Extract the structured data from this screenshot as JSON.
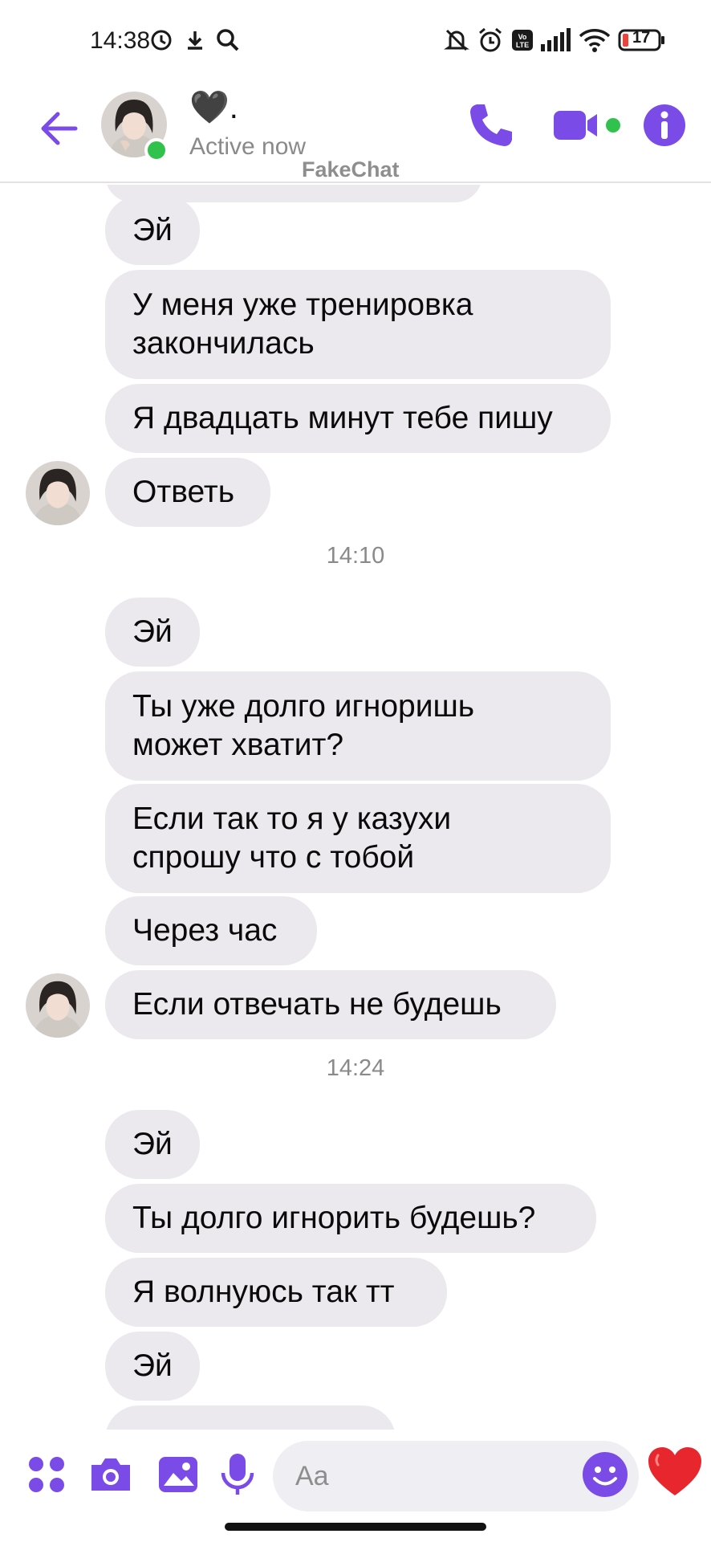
{
  "status_bar": {
    "time": "14:38",
    "battery": "17",
    "icons": [
      "clock-icon",
      "download-icon",
      "search-icon",
      "bell-off-icon",
      "alarm-icon",
      "volte-icon",
      "signal-icon",
      "wifi-icon",
      "battery-icon"
    ]
  },
  "header": {
    "contact_name": "🖤.",
    "contact_status": "Active now",
    "watermark": "FakeChat",
    "accent_color": "#7b4be8",
    "online_color": "#31c24d"
  },
  "messages": [
    {
      "text": "Эй",
      "avatar": false
    },
    {
      "text": "У меня уже тренировка\nзакончилась",
      "avatar": false
    },
    {
      "text": "Я двадцать минут тебе пишу",
      "avatar": false
    },
    {
      "text": "Ответь",
      "avatar": true
    },
    {
      "separator": "14:10"
    },
    {
      "text": "Эй",
      "avatar": false
    },
    {
      "text": "Ты уже долго игноришь\nможет хватит?",
      "avatar": false
    },
    {
      "text": "Если так то я у казухи\nспрошу что с тобой",
      "avatar": false
    },
    {
      "text": "Через час",
      "avatar": false
    },
    {
      "text": "Если отвечать не будешь",
      "avatar": true
    },
    {
      "separator": "14:24"
    },
    {
      "text": "Эй",
      "avatar": false
    },
    {
      "text": "Ты долго игнорить будешь?",
      "avatar": false
    },
    {
      "text": "Я волнуюсь так тт",
      "avatar": false
    },
    {
      "text": "Эй",
      "avatar": false
    }
  ],
  "composer": {
    "placeholder": "Aa",
    "icons": [
      "apps-icon",
      "camera-icon",
      "gallery-icon",
      "microphone-icon",
      "emoji-icon",
      "heart-icon"
    ]
  }
}
